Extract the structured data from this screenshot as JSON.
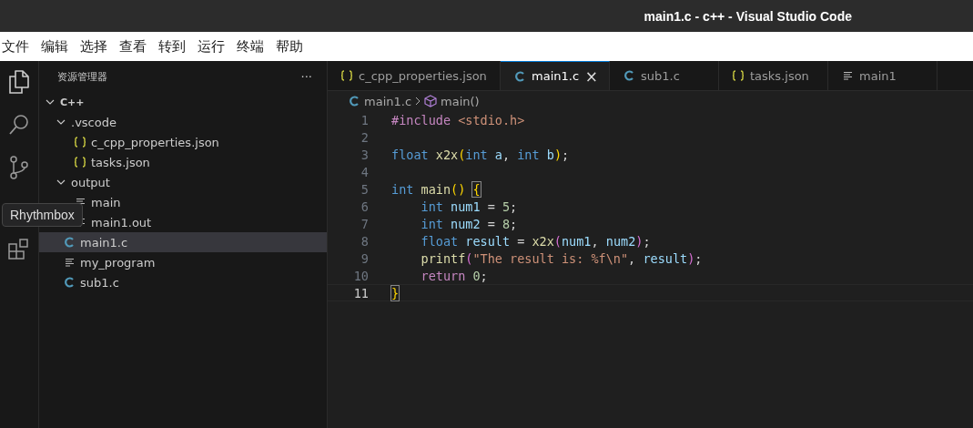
{
  "window": {
    "title": "main1.c - c++ - Visual Studio Code"
  },
  "menu": [
    "文件",
    "编辑",
    "选择",
    "查看",
    "转到",
    "运行",
    "终端",
    "帮助"
  ],
  "tooltip": "Rhythmbox",
  "sidebar": {
    "title": "资源管理器",
    "more": "···",
    "tree": [
      {
        "label": "C++",
        "kind": "root",
        "expanded": true,
        "selected": false,
        "children": [
          {
            "label": ".vscode",
            "kind": "folder",
            "expanded": true,
            "selected": false,
            "children": [
              {
                "label": "c_cpp_properties.json",
                "kind": "json",
                "selected": false
              },
              {
                "label": "tasks.json",
                "kind": "json",
                "selected": false
              }
            ]
          },
          {
            "label": "output",
            "kind": "folder",
            "expanded": true,
            "selected": false,
            "children": [
              {
                "label": "main",
                "kind": "binary",
                "selected": false
              },
              {
                "label": "main1.out",
                "kind": "binary",
                "selected": false
              }
            ]
          },
          {
            "label": "main1.c",
            "kind": "c",
            "selected": true
          },
          {
            "label": "my_program",
            "kind": "binary",
            "selected": false
          },
          {
            "label": "sub1.c",
            "kind": "c",
            "selected": false
          }
        ]
      }
    ]
  },
  "tabs": [
    {
      "label": "c_cpp_properties.json",
      "kind": "json",
      "selected": false
    },
    {
      "label": "main1.c",
      "kind": "c",
      "selected": true,
      "close": "×"
    },
    {
      "label": "sub1.c",
      "kind": "c",
      "selected": false
    },
    {
      "label": "tasks.json",
      "kind": "json",
      "selected": false
    },
    {
      "label": "main1",
      "kind": "binary",
      "selected": false
    }
  ],
  "breadcrumb": [
    {
      "label": "main1.c",
      "kind": "c"
    },
    {
      "label": "main()",
      "kind": "function"
    }
  ],
  "editor": {
    "lines": [
      {
        "number": "1",
        "current": false,
        "tokens": [
          {
            "text": "#include ",
            "kind": "preproc"
          },
          {
            "text": "<stdio.h>",
            "kind": "string"
          }
        ]
      },
      {
        "number": "2",
        "current": false
      },
      {
        "number": "3",
        "current": false,
        "tokens": [
          {
            "text": "float ",
            "kind": "keyword"
          },
          {
            "text": "x2x",
            "kind": "function"
          },
          {
            "text": "(",
            "kind": "bracket1"
          },
          {
            "text": "int ",
            "kind": "keyword"
          },
          {
            "text": "a",
            "kind": "variable"
          },
          {
            "text": ", ",
            "kind": "plain"
          },
          {
            "text": "int ",
            "kind": "keyword"
          },
          {
            "text": "b",
            "kind": "variable"
          },
          {
            "text": ")",
            "kind": "bracket1"
          },
          {
            "text": ";",
            "kind": "plain"
          }
        ]
      },
      {
        "number": "4",
        "current": false
      },
      {
        "number": "5",
        "current": false,
        "tokens": [
          {
            "text": "int ",
            "kind": "keyword"
          },
          {
            "text": "main",
            "kind": "function"
          },
          {
            "text": "() ",
            "kind": "bracket1"
          },
          {
            "text": "{",
            "kind": "bracket1",
            "matched": true
          }
        ]
      },
      {
        "number": "6",
        "current": false,
        "tokens": [
          {
            "text": "    int ",
            "kind": "keyword"
          },
          {
            "text": "num1",
            "kind": "variable"
          },
          {
            "text": " = ",
            "kind": "plain"
          },
          {
            "text": "5",
            "kind": "number"
          },
          {
            "text": ";",
            "kind": "plain"
          }
        ]
      },
      {
        "number": "7",
        "current": false,
        "tokens": [
          {
            "text": "    int ",
            "kind": "keyword"
          },
          {
            "text": "num2",
            "kind": "variable"
          },
          {
            "text": " = ",
            "kind": "plain"
          },
          {
            "text": "8",
            "kind": "number"
          },
          {
            "text": ";",
            "kind": "plain"
          }
        ]
      },
      {
        "number": "8",
        "current": false,
        "tokens": [
          {
            "text": "    float ",
            "kind": "keyword"
          },
          {
            "text": "result",
            "kind": "variable"
          },
          {
            "text": " = ",
            "kind": "plain"
          },
          {
            "text": "x2x",
            "kind": "function"
          },
          {
            "text": "(",
            "kind": "bracket2"
          },
          {
            "text": "num1",
            "kind": "variable"
          },
          {
            "text": ", ",
            "kind": "plain"
          },
          {
            "text": "num2",
            "kind": "variable"
          },
          {
            "text": ")",
            "kind": "bracket2"
          },
          {
            "text": ";",
            "kind": "plain"
          }
        ]
      },
      {
        "number": "9",
        "current": false,
        "tokens": [
          {
            "text": "    printf",
            "kind": "function"
          },
          {
            "text": "(",
            "kind": "bracket2"
          },
          {
            "text": "\"The result is: %f\\n\"",
            "kind": "string"
          },
          {
            "text": ", ",
            "kind": "plain"
          },
          {
            "text": "result",
            "kind": "variable"
          },
          {
            "text": ")",
            "kind": "bracket2"
          },
          {
            "text": ";",
            "kind": "plain"
          }
        ]
      },
      {
        "number": "10",
        "current": false,
        "tokens": [
          {
            "text": "    return ",
            "kind": "control"
          },
          {
            "text": "0",
            "kind": "number"
          },
          {
            "text": ";",
            "kind": "plain"
          }
        ]
      },
      {
        "number": "11",
        "current": true,
        "tokens": [
          {
            "text": "}",
            "kind": "bracket1",
            "matched": true
          }
        ]
      }
    ]
  }
}
